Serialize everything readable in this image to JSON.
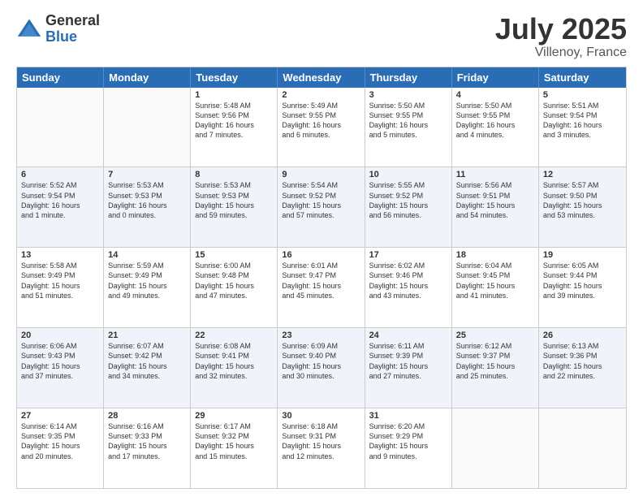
{
  "logo": {
    "general": "General",
    "blue": "Blue"
  },
  "title": "July 2025",
  "location": "Villenoy, France",
  "header_days": [
    "Sunday",
    "Monday",
    "Tuesday",
    "Wednesday",
    "Thursday",
    "Friday",
    "Saturday"
  ],
  "weeks": [
    {
      "alt": false,
      "cells": [
        {
          "day": "",
          "info": ""
        },
        {
          "day": "",
          "info": ""
        },
        {
          "day": "1",
          "info": "Sunrise: 5:48 AM\nSunset: 9:56 PM\nDaylight: 16 hours\nand 7 minutes."
        },
        {
          "day": "2",
          "info": "Sunrise: 5:49 AM\nSunset: 9:55 PM\nDaylight: 16 hours\nand 6 minutes."
        },
        {
          "day": "3",
          "info": "Sunrise: 5:50 AM\nSunset: 9:55 PM\nDaylight: 16 hours\nand 5 minutes."
        },
        {
          "day": "4",
          "info": "Sunrise: 5:50 AM\nSunset: 9:55 PM\nDaylight: 16 hours\nand 4 minutes."
        },
        {
          "day": "5",
          "info": "Sunrise: 5:51 AM\nSunset: 9:54 PM\nDaylight: 16 hours\nand 3 minutes."
        }
      ]
    },
    {
      "alt": true,
      "cells": [
        {
          "day": "6",
          "info": "Sunrise: 5:52 AM\nSunset: 9:54 PM\nDaylight: 16 hours\nand 1 minute."
        },
        {
          "day": "7",
          "info": "Sunrise: 5:53 AM\nSunset: 9:53 PM\nDaylight: 16 hours\nand 0 minutes."
        },
        {
          "day": "8",
          "info": "Sunrise: 5:53 AM\nSunset: 9:53 PM\nDaylight: 15 hours\nand 59 minutes."
        },
        {
          "day": "9",
          "info": "Sunrise: 5:54 AM\nSunset: 9:52 PM\nDaylight: 15 hours\nand 57 minutes."
        },
        {
          "day": "10",
          "info": "Sunrise: 5:55 AM\nSunset: 9:52 PM\nDaylight: 15 hours\nand 56 minutes."
        },
        {
          "day": "11",
          "info": "Sunrise: 5:56 AM\nSunset: 9:51 PM\nDaylight: 15 hours\nand 54 minutes."
        },
        {
          "day": "12",
          "info": "Sunrise: 5:57 AM\nSunset: 9:50 PM\nDaylight: 15 hours\nand 53 minutes."
        }
      ]
    },
    {
      "alt": false,
      "cells": [
        {
          "day": "13",
          "info": "Sunrise: 5:58 AM\nSunset: 9:49 PM\nDaylight: 15 hours\nand 51 minutes."
        },
        {
          "day": "14",
          "info": "Sunrise: 5:59 AM\nSunset: 9:49 PM\nDaylight: 15 hours\nand 49 minutes."
        },
        {
          "day": "15",
          "info": "Sunrise: 6:00 AM\nSunset: 9:48 PM\nDaylight: 15 hours\nand 47 minutes."
        },
        {
          "day": "16",
          "info": "Sunrise: 6:01 AM\nSunset: 9:47 PM\nDaylight: 15 hours\nand 45 minutes."
        },
        {
          "day": "17",
          "info": "Sunrise: 6:02 AM\nSunset: 9:46 PM\nDaylight: 15 hours\nand 43 minutes."
        },
        {
          "day": "18",
          "info": "Sunrise: 6:04 AM\nSunset: 9:45 PM\nDaylight: 15 hours\nand 41 minutes."
        },
        {
          "day": "19",
          "info": "Sunrise: 6:05 AM\nSunset: 9:44 PM\nDaylight: 15 hours\nand 39 minutes."
        }
      ]
    },
    {
      "alt": true,
      "cells": [
        {
          "day": "20",
          "info": "Sunrise: 6:06 AM\nSunset: 9:43 PM\nDaylight: 15 hours\nand 37 minutes."
        },
        {
          "day": "21",
          "info": "Sunrise: 6:07 AM\nSunset: 9:42 PM\nDaylight: 15 hours\nand 34 minutes."
        },
        {
          "day": "22",
          "info": "Sunrise: 6:08 AM\nSunset: 9:41 PM\nDaylight: 15 hours\nand 32 minutes."
        },
        {
          "day": "23",
          "info": "Sunrise: 6:09 AM\nSunset: 9:40 PM\nDaylight: 15 hours\nand 30 minutes."
        },
        {
          "day": "24",
          "info": "Sunrise: 6:11 AM\nSunset: 9:39 PM\nDaylight: 15 hours\nand 27 minutes."
        },
        {
          "day": "25",
          "info": "Sunrise: 6:12 AM\nSunset: 9:37 PM\nDaylight: 15 hours\nand 25 minutes."
        },
        {
          "day": "26",
          "info": "Sunrise: 6:13 AM\nSunset: 9:36 PM\nDaylight: 15 hours\nand 22 minutes."
        }
      ]
    },
    {
      "alt": false,
      "cells": [
        {
          "day": "27",
          "info": "Sunrise: 6:14 AM\nSunset: 9:35 PM\nDaylight: 15 hours\nand 20 minutes."
        },
        {
          "day": "28",
          "info": "Sunrise: 6:16 AM\nSunset: 9:33 PM\nDaylight: 15 hours\nand 17 minutes."
        },
        {
          "day": "29",
          "info": "Sunrise: 6:17 AM\nSunset: 9:32 PM\nDaylight: 15 hours\nand 15 minutes."
        },
        {
          "day": "30",
          "info": "Sunrise: 6:18 AM\nSunset: 9:31 PM\nDaylight: 15 hours\nand 12 minutes."
        },
        {
          "day": "31",
          "info": "Sunrise: 6:20 AM\nSunset: 9:29 PM\nDaylight: 15 hours\nand 9 minutes."
        },
        {
          "day": "",
          "info": ""
        },
        {
          "day": "",
          "info": ""
        }
      ]
    }
  ]
}
